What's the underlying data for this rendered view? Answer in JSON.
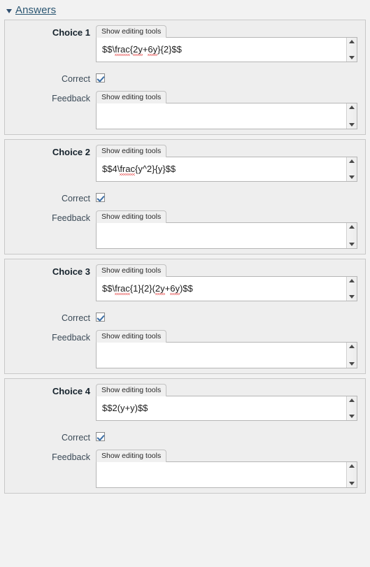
{
  "section": {
    "title": "Answers",
    "collapse_icon": "triangle-down-icon",
    "expanded": true
  },
  "labels": {
    "correct": "Correct",
    "feedback": "Feedback",
    "editor_toggle": "Show editing tools"
  },
  "colors": {
    "page_background": "#f2f2f2",
    "panel_background": "#eeeeee",
    "panel_border": "#c8c8c8",
    "link": "#2b5672",
    "checkbox_check": "#3b6ea5",
    "spellcheck_underline": "#e02020",
    "field_text": "#1c1c1c"
  },
  "choices": [
    {
      "label": "Choice 1",
      "answer_value": "$$\\frac{2y+6y}{2}$$",
      "answer_tokens": [
        {
          "t": "$$\\",
          "sq": false
        },
        {
          "t": "frac",
          "sq": true
        },
        {
          "t": "{",
          "sq": false
        },
        {
          "t": "2y",
          "sq": true
        },
        {
          "t": "+",
          "sq": false
        },
        {
          "t": "6y",
          "sq": true
        },
        {
          "t": "}{2}$$",
          "sq": false
        }
      ],
      "correct": true,
      "feedback_value": ""
    },
    {
      "label": "Choice 2",
      "answer_value": "$$4\\frac{y^2}{y}$$",
      "answer_tokens": [
        {
          "t": "$$4\\",
          "sq": false
        },
        {
          "t": "frac",
          "sq": true
        },
        {
          "t": "{y^2}{y}$$",
          "sq": false
        }
      ],
      "correct": true,
      "feedback_value": ""
    },
    {
      "label": "Choice 3",
      "answer_value": "$$\\frac{1}{2}(2y+6y)$$",
      "answer_tokens": [
        {
          "t": "$$\\",
          "sq": false
        },
        {
          "t": "frac",
          "sq": true
        },
        {
          "t": "{1}{2}(",
          "sq": false
        },
        {
          "t": "2y",
          "sq": true
        },
        {
          "t": "+",
          "sq": false
        },
        {
          "t": "6y",
          "sq": true
        },
        {
          "t": ")$$",
          "sq": false
        }
      ],
      "correct": true,
      "feedback_value": ""
    },
    {
      "label": "Choice 4",
      "answer_value": "$$2(y+y)$$",
      "answer_tokens": [
        {
          "t": "$$2(y+y)$$",
          "sq": false
        }
      ],
      "correct": true,
      "feedback_value": ""
    }
  ],
  "scrollbar": {
    "up_icon": "triangle-up-icon",
    "down_icon": "triangle-down-icon"
  }
}
